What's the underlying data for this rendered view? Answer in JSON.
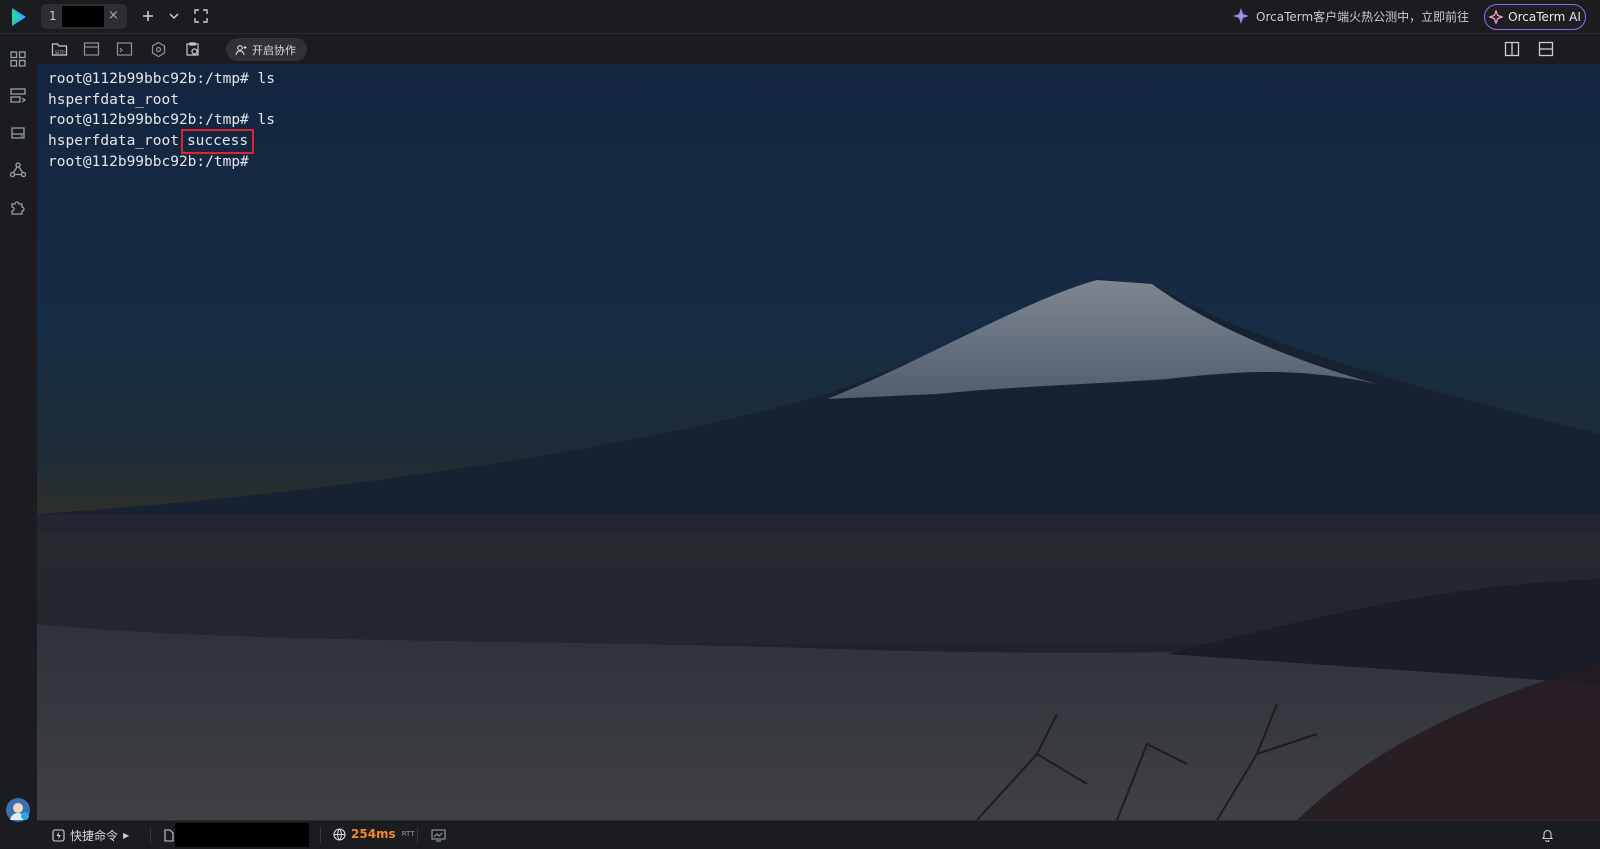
{
  "tabs": [
    {
      "number": "1",
      "close": "×"
    }
  ],
  "promo": {
    "text": "OrcaTerm客户端火热公测中，立即前往"
  },
  "ai_button": {
    "label": "OrcaTerm AI"
  },
  "toolbar": {
    "collab_label": "开启协作"
  },
  "terminal": {
    "lines": [
      "root@112b99bbc92b:/tmp# ls",
      "hsperfdata_root",
      "root@112b99bbc92b:/tmp# ls",
      "hsperfdata_root",
      "root@112b99bbc92b:/tmp#"
    ],
    "highlighted_item": "success"
  },
  "status_bar": {
    "quick_commands": "快捷命令",
    "latency": "254ms",
    "latency_unit": "RTT"
  },
  "colors": {
    "accent": "#8b6df0",
    "highlight_box": "#e0242f",
    "latency": "#f08a2c"
  }
}
